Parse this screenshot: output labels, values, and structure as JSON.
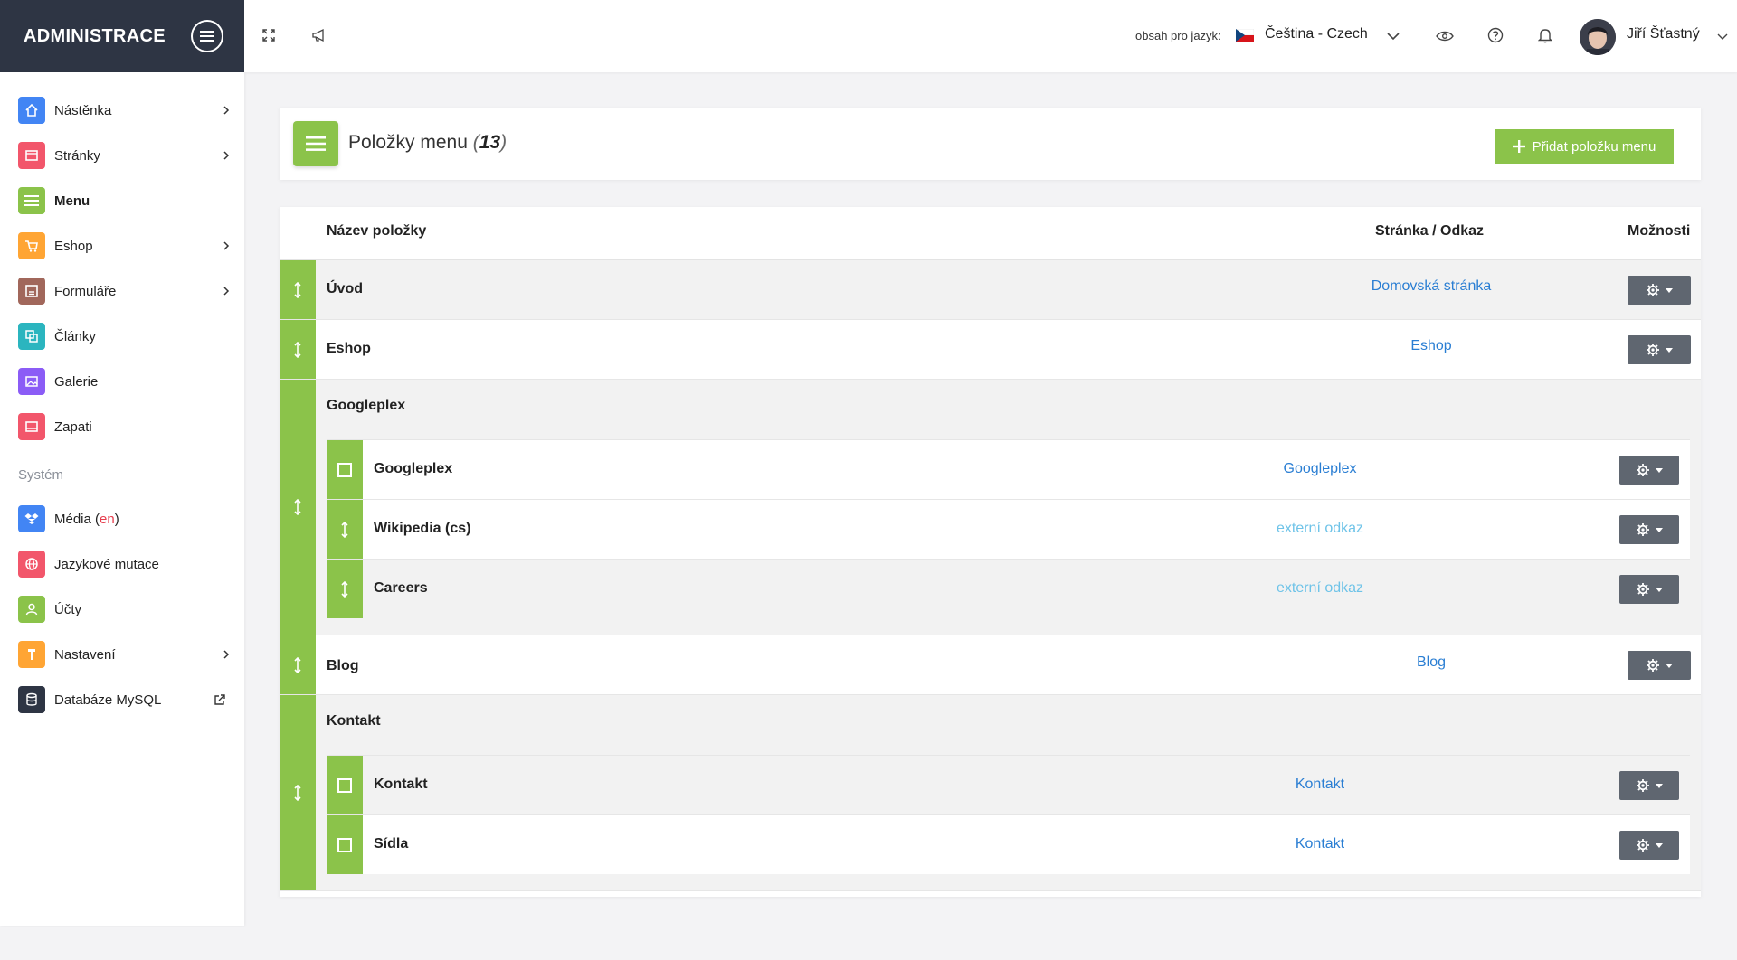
{
  "brand": {
    "title": "ADMINISTRACE"
  },
  "sidebar": {
    "items": [
      {
        "label": "Nástěnka",
        "icon": "home-icon",
        "color": "#4285f4",
        "arrow": true
      },
      {
        "label": "Stránky",
        "icon": "browser-icon",
        "color": "#f2566b",
        "arrow": true
      },
      {
        "label": "Menu",
        "icon": "menu-icon",
        "color": "#8bc34a",
        "arrow": false,
        "active": true
      },
      {
        "label": "Eshop",
        "icon": "cart-icon",
        "color": "#ffa534",
        "arrow": true
      },
      {
        "label": "Formuláře",
        "icon": "form-icon",
        "color": "#a1675b",
        "arrow": true
      },
      {
        "label": "Články",
        "icon": "articles-icon",
        "color": "#2bb5bf",
        "arrow": false
      },
      {
        "label": "Galerie",
        "icon": "gallery-icon",
        "color": "#8b5cf6",
        "arrow": false
      },
      {
        "label": "Zapati",
        "icon": "footer-icon",
        "color": "#f2566b",
        "arrow": false
      }
    ],
    "section_label": "Systém",
    "system_items": [
      {
        "label": "Média",
        "suffix_open": " (",
        "suffix": "en",
        "suffix_close": ")",
        "icon": "dropbox-icon",
        "color": "#4285f4",
        "arrow": false
      },
      {
        "label": "Jazykové mutace",
        "icon": "globe-icon",
        "color": "#f2566b",
        "arrow": false
      },
      {
        "label": "Účty",
        "icon": "user-icon",
        "color": "#8bc34a",
        "arrow": false
      },
      {
        "label": "Nastavení",
        "icon": "hammer-icon",
        "color": "#ffa534",
        "arrow": true
      },
      {
        "label": "Databáze MySQL",
        "icon": "database-icon",
        "color": "#2e3544",
        "arrow": false,
        "external": true
      }
    ]
  },
  "topbar": {
    "lang_caption": "obsah pro jazyk:",
    "lang_value": "Čeština - Czech",
    "user_name": "Jiří Šťastný"
  },
  "header": {
    "title": "Položky menu",
    "count_open": "(",
    "count": "13",
    "count_close": ")",
    "add_button": "Přidat položku menu"
  },
  "table": {
    "col_name": "Název položky",
    "col_link": "Stránka / Odkaz",
    "col_options": "Možnosti",
    "rows": [
      {
        "name": "Úvod",
        "link": "Domovská stránka"
      },
      {
        "name": "Eshop",
        "link": "Eshop"
      },
      {
        "name": "Googleplex",
        "children": [
          {
            "name": "Googleplex",
            "link": "Googleplex"
          },
          {
            "name": "Wikipedia (cs)",
            "link": "externí odkaz"
          },
          {
            "name": "Careers",
            "link": "externí odkaz"
          }
        ]
      },
      {
        "name": "Blog",
        "link": "Blog"
      },
      {
        "name": "Kontakt",
        "children": [
          {
            "name": "Kontakt",
            "link": "Kontakt"
          },
          {
            "name": "Sídla",
            "link": "Kontakt"
          }
        ]
      }
    ]
  },
  "colors": {
    "accent": "#8bc34a",
    "dark": "#2e3544",
    "link": "#2a7ed3",
    "external_link": "#6ec3e8"
  }
}
